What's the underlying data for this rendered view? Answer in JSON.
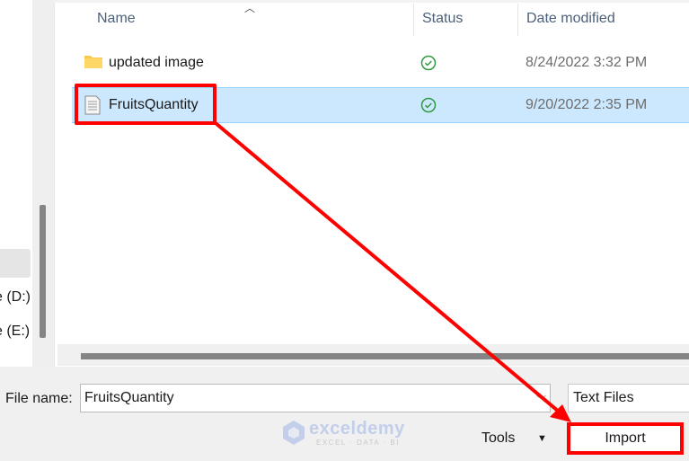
{
  "nav": {
    "items": [
      {
        "label": "e (D:)"
      },
      {
        "label": "e (E:)"
      }
    ]
  },
  "columns": {
    "name": "Name",
    "status": "Status",
    "date_modified": "Date modified"
  },
  "files": [
    {
      "name": "updated image",
      "type": "folder",
      "status": "synced",
      "date": "8/24/2022 3:32 PM",
      "selected": false
    },
    {
      "name": "FruitsQuantity",
      "type": "text-file",
      "status": "synced",
      "date": "9/20/2022 2:35 PM",
      "selected": true
    }
  ],
  "footer": {
    "file_name_label": "File name:",
    "file_name_value": "FruitsQuantity",
    "file_type": "Text Files",
    "tools_label": "Tools",
    "import_label": "Import"
  },
  "watermark": {
    "brand": "exceldemy",
    "tagline": "EXCEL · DATA · BI"
  },
  "annotation": {
    "color": "#ff0000"
  },
  "colors": {
    "selection": "#cce8ff",
    "status_ok": "#2e9a3e"
  }
}
